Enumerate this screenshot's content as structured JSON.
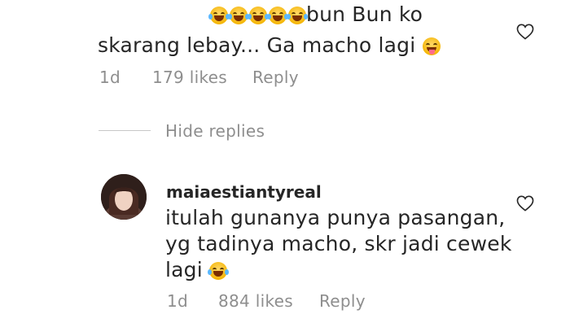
{
  "first_comment": {
    "line1_text": "bun Bun ko",
    "line2_text": "skarang lebay... Ga macho lagi",
    "age": "1d",
    "likes": "179 likes",
    "reply_label": "Reply"
  },
  "hide_replies_label": "Hide replies",
  "reply_comment": {
    "username": "maiaestiantyreal",
    "line1": "itulah gunanya punya pasangan,",
    "line2": "yg tadinya macho, skr jadi cewek",
    "line3": "lagi",
    "age": "1d",
    "likes": "884 likes",
    "reply_label": "Reply"
  },
  "icons": {
    "like": "heart-outline-icon",
    "laugh": "face-with-tears-of-joy-emoji",
    "tongue": "face-with-tongue-emoji"
  },
  "colors": {
    "text": "#262626",
    "muted": "#8e8e8e",
    "divider": "#c7c7c7"
  }
}
